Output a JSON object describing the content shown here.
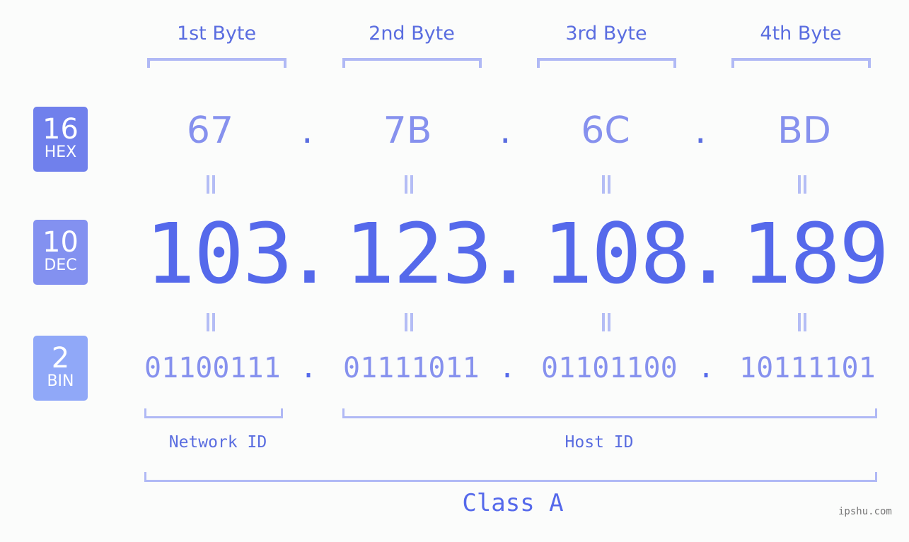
{
  "badges": [
    {
      "num": "16",
      "label": "HEX",
      "color": "#7080ec"
    },
    {
      "num": "10",
      "label": "DEC",
      "color": "#8391f0"
    },
    {
      "num": "2",
      "label": "BIN",
      "color": "#90a8f8"
    }
  ],
  "byte_labels": [
    "1st Byte",
    "2nd Byte",
    "3rd Byte",
    "4th Byte"
  ],
  "hex": [
    "67",
    "7B",
    "6C",
    "BD"
  ],
  "dec": [
    "103",
    "123",
    "108",
    "189"
  ],
  "bin": [
    "01100111",
    "01111011",
    "01101100",
    "10111101"
  ],
  "separator": ".",
  "network_id_label": "Network ID",
  "host_id_label": "Host ID",
  "class_label": "Class A",
  "watermark": "ipshu.com"
}
